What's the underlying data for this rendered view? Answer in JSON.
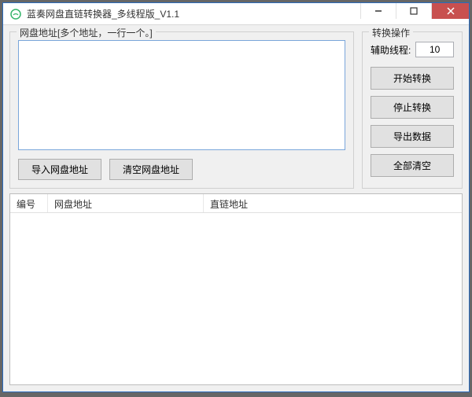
{
  "window": {
    "title": "蓝奏网盘直链转换器_多线程版_V1.1"
  },
  "leftGroup": {
    "legend": "网盘地址[多个地址，一行一个。]",
    "textareaValue": "",
    "importBtn": "导入网盘地址",
    "clearBtn": "清空网盘地址"
  },
  "rightGroup": {
    "legend": "转换操作",
    "threadLabel": "辅助线程:",
    "threadValue": "10",
    "startBtn": "开始转换",
    "stopBtn": "停止转换",
    "exportBtn": "导出数据",
    "clearAllBtn": "全部清空"
  },
  "table": {
    "colNum": "编号",
    "colUrl": "网盘地址",
    "colDirect": "直链地址",
    "rows": []
  }
}
